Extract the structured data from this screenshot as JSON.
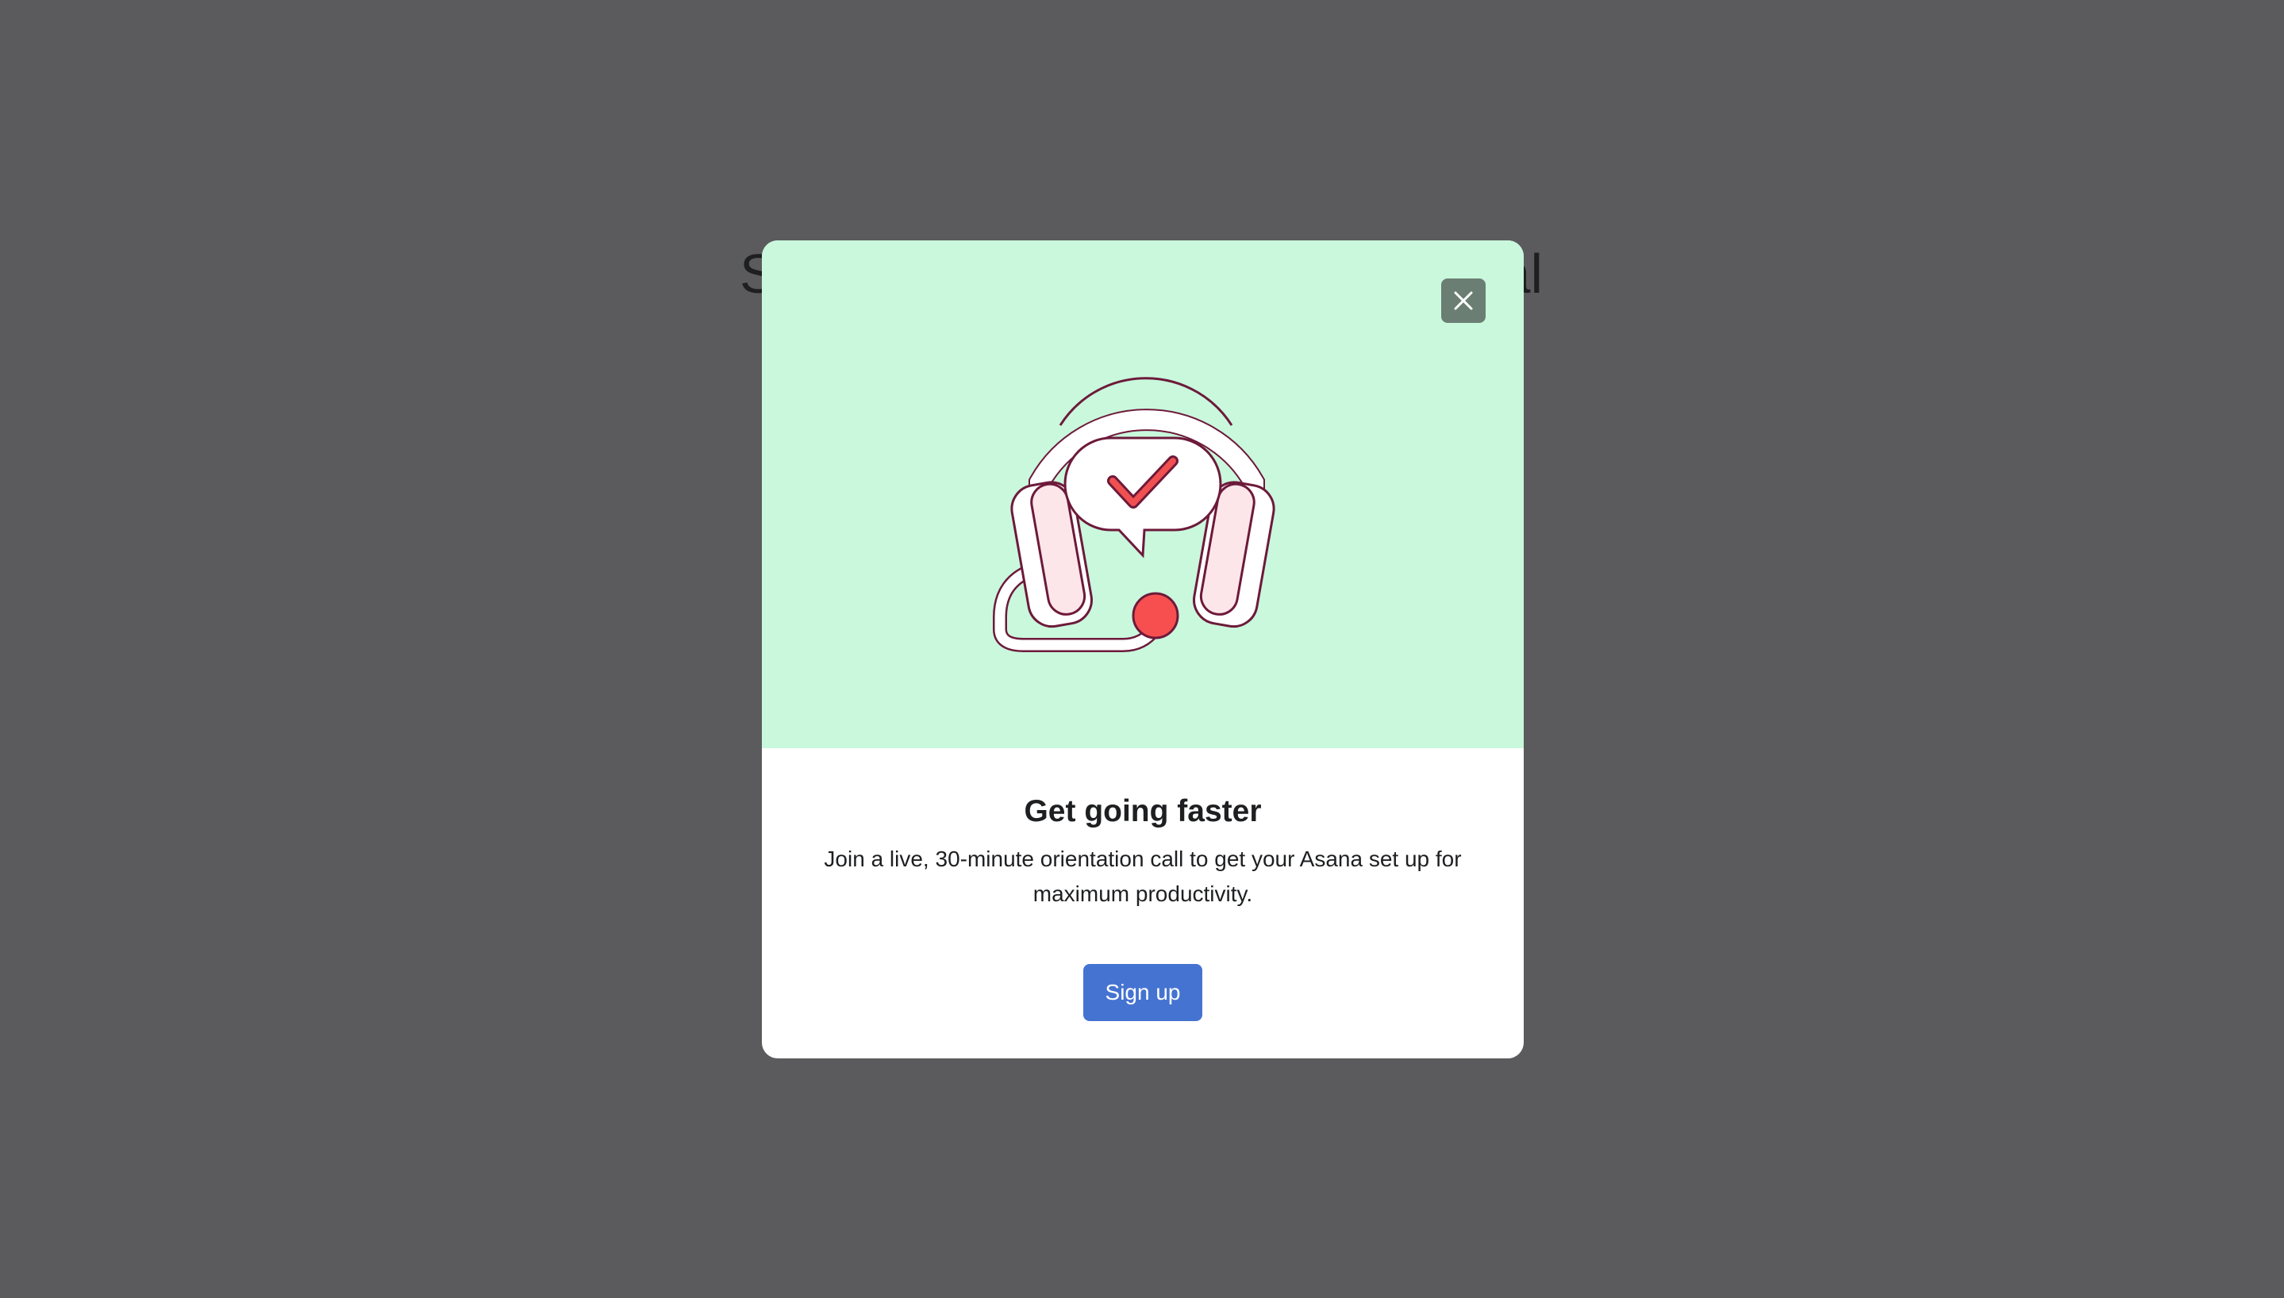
{
  "background": {
    "heading_left": "S",
    "heading_right": "al"
  },
  "modal": {
    "title": "Get going faster",
    "body": "Join a live, 30-minute orientation call to get your Asana set up for maximum productivity.",
    "cta_label": "Sign up",
    "close_icon": "close-icon",
    "illustration_icon": "headset-checkmark-icon"
  },
  "colors": {
    "backdrop": "#5b5b5d",
    "hero": "#c9f8dd",
    "button": "#4573d2",
    "close_button": "#6b7e73",
    "accent_red": "#f06a6a"
  }
}
